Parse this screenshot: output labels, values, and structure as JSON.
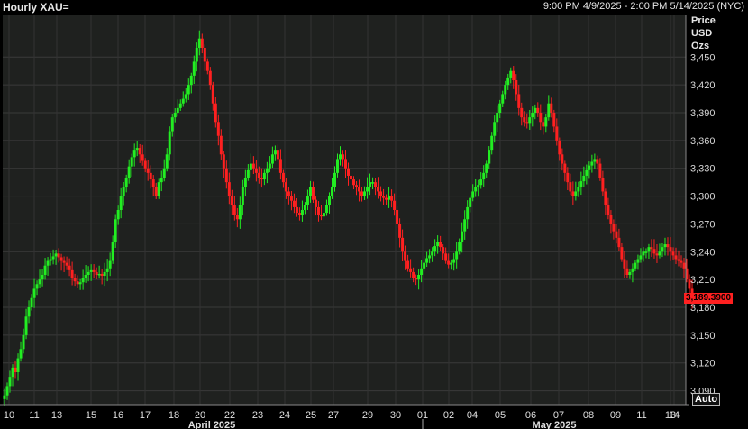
{
  "header": {
    "title": "Hourly XAU=",
    "range": "9:00 PM 4/9/2025 - 2:00 PM 5/14/2025 (NYC)"
  },
  "axis_units": [
    "Price",
    "USD",
    "Ozs"
  ],
  "auto_label": "Auto",
  "colors": {
    "up": "#22ee22",
    "down": "#ff2020",
    "background": "#1f211f",
    "grid": "#3a3a3a"
  },
  "chart_data": {
    "type": "line",
    "style": "candlestick",
    "ylim": [
      3075,
      3495
    ],
    "yticks": [
      "3,090",
      "3,120",
      "3,150",
      "3,180",
      "3,210",
      "3,240",
      "3,270",
      "3,300",
      "3,330",
      "3,360",
      "3,390",
      "3,420",
      "3,450"
    ],
    "ytick_values": [
      3090,
      3120,
      3150,
      3180,
      3210,
      3240,
      3270,
      3300,
      3330,
      3360,
      3390,
      3420,
      3450
    ],
    "last_price": "3,189.3900",
    "last_value": 3189.39,
    "day_labels": [
      "10",
      "11",
      "13",
      "15",
      "16",
      "17",
      "18",
      "20",
      "22",
      "23",
      "24",
      "25",
      "27",
      "29",
      "30",
      "01",
      "02",
      "04",
      "05",
      "06",
      "07",
      "08",
      "09",
      "11",
      "13",
      "14"
    ],
    "month_labels": [
      "April 2025",
      "May 2025"
    ],
    "x": [
      0,
      1,
      2,
      3,
      4,
      5,
      6,
      7,
      8,
      9,
      10,
      11,
      12,
      13,
      14,
      15,
      16,
      17,
      18,
      19,
      20,
      21,
      22,
      23,
      24,
      25,
      26,
      27,
      28,
      29,
      30,
      31,
      32,
      33,
      34,
      35,
      36,
      37,
      38,
      39,
      40,
      41,
      42,
      43,
      44,
      45,
      46,
      47,
      48,
      49,
      50,
      51,
      52,
      53,
      54,
      55,
      56,
      57,
      58,
      59,
      60,
      61,
      62,
      63,
      64,
      65,
      66,
      67,
      68,
      69,
      70,
      71,
      72,
      73,
      74,
      75,
      76,
      77,
      78,
      79,
      80,
      81,
      82,
      83,
      84,
      85,
      86,
      87,
      88,
      89,
      90,
      91,
      92,
      93,
      94,
      95,
      96,
      97,
      98,
      99,
      100,
      101,
      102,
      103,
      104,
      105,
      106,
      107,
      108,
      109,
      110,
      111,
      112,
      113,
      114,
      115,
      116,
      117,
      118,
      119,
      120,
      121,
      122,
      123,
      124,
      125,
      126,
      127,
      128,
      129,
      130,
      131,
      132,
      133,
      134,
      135,
      136,
      137,
      138,
      139,
      140,
      141,
      142,
      143,
      144,
      145,
      146,
      147,
      148,
      149,
      150,
      151,
      152,
      153,
      154,
      155,
      156,
      157,
      158,
      159,
      160,
      161,
      162,
      163,
      164,
      165,
      166,
      167,
      168,
      169,
      170,
      171,
      172,
      173,
      174,
      175,
      176,
      177,
      178,
      179,
      180,
      181,
      182,
      183,
      184,
      185,
      186,
      187,
      188,
      189,
      190,
      191,
      192,
      193,
      194,
      195,
      196,
      197,
      198,
      199,
      200,
      201,
      202,
      203,
      204,
      205,
      206,
      207,
      208,
      209,
      210,
      211,
      212,
      213,
      214,
      215,
      216,
      217,
      218,
      219,
      220,
      221,
      222,
      223,
      224,
      225,
      226,
      227,
      228,
      229,
      230,
      231,
      232,
      233,
      234,
      235,
      236,
      237,
      238,
      239,
      240,
      241,
      242,
      243,
      244,
      245,
      246,
      247,
      248,
      249,
      250
    ],
    "series": [
      {
        "values": [
          3085,
          3095,
          3105,
          3115,
          3110,
          3125,
          3135,
          3150,
          3170,
          3180,
          3190,
          3200,
          3205,
          3210,
          3215,
          3225,
          3230,
          3232,
          3235,
          3238,
          3234,
          3230,
          3228,
          3225,
          3220,
          3212,
          3208,
          3205,
          3207,
          3212,
          3215,
          3218,
          3220,
          3218,
          3215,
          3216,
          3214,
          3218,
          3222,
          3230,
          3250,
          3275,
          3285,
          3300,
          3310,
          3320,
          3332,
          3342,
          3350,
          3352,
          3345,
          3338,
          3330,
          3325,
          3318,
          3310,
          3300,
          3315,
          3320,
          3330,
          3345,
          3370,
          3385,
          3390,
          3395,
          3400,
          3405,
          3410,
          3420,
          3430,
          3445,
          3460,
          3470,
          3460,
          3445,
          3435,
          3420,
          3400,
          3380,
          3365,
          3345,
          3330,
          3315,
          3300,
          3290,
          3280,
          3275,
          3290,
          3310,
          3320,
          3328,
          3335,
          3330,
          3325,
          3320,
          3318,
          3325,
          3330,
          3335,
          3345,
          3350,
          3340,
          3325,
          3315,
          3305,
          3300,
          3295,
          3288,
          3282,
          3280,
          3285,
          3290,
          3300,
          3310,
          3296,
          3288,
          3280,
          3278,
          3282,
          3290,
          3300,
          3310,
          3325,
          3340,
          3345,
          3340,
          3330,
          3322,
          3318,
          3312,
          3310,
          3305,
          3300,
          3305,
          3310,
          3315,
          3315,
          3310,
          3305,
          3300,
          3298,
          3296,
          3300,
          3295,
          3285,
          3270,
          3255,
          3240,
          3230,
          3222,
          3218,
          3212,
          3210,
          3215,
          3222,
          3228,
          3233,
          3236,
          3240,
          3246,
          3250,
          3245,
          3238,
          3230,
          3226,
          3228,
          3232,
          3240,
          3250,
          3262,
          3275,
          3288,
          3298,
          3305,
          3310,
          3312,
          3318,
          3325,
          3335,
          3350,
          3365,
          3380,
          3390,
          3400,
          3410,
          3420,
          3428,
          3435,
          3425,
          3410,
          3395,
          3385,
          3380,
          3378,
          3385,
          3390,
          3395,
          3390,
          3380,
          3375,
          3385,
          3400,
          3390,
          3375,
          3360,
          3345,
          3335,
          3325,
          3315,
          3305,
          3300,
          3305,
          3310,
          3316,
          3322,
          3328,
          3333,
          3337,
          3340,
          3335,
          3320,
          3305,
          3290,
          3280,
          3270,
          3262,
          3255,
          3245,
          3232,
          3222,
          3215,
          3218,
          3222,
          3228,
          3232,
          3236,
          3240,
          3240,
          3245,
          3243,
          3238,
          3236,
          3240,
          3245,
          3248,
          3245,
          3240,
          3236,
          3232,
          3230,
          3228,
          3222,
          3210,
          3200,
          3189.39
        ]
      }
    ]
  }
}
